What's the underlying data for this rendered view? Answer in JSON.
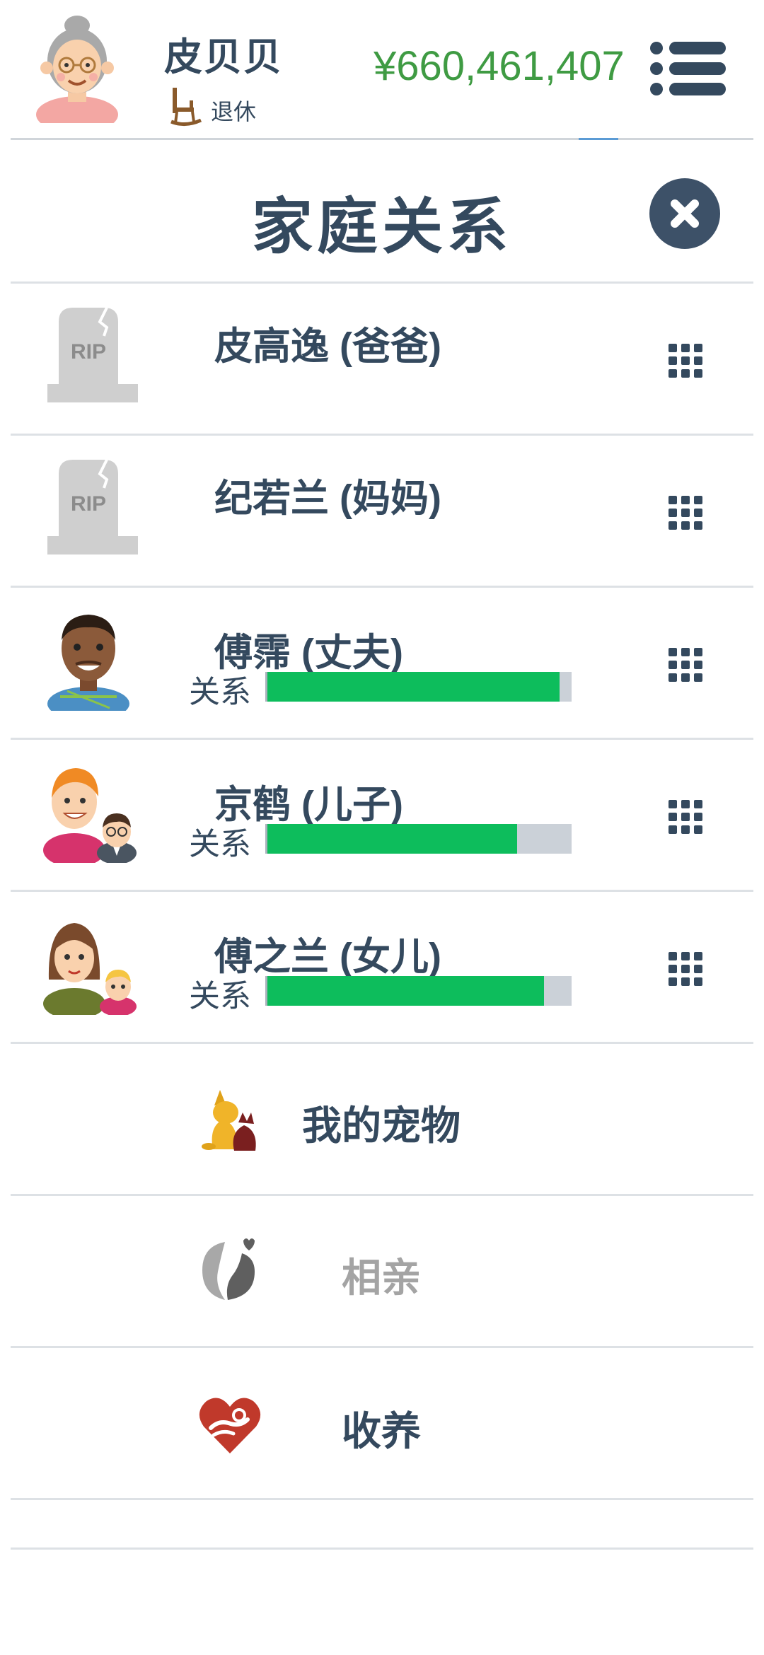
{
  "header": {
    "player_name": "皮贝贝",
    "status": "退休",
    "money": "¥660,461,407"
  },
  "modal": {
    "title": "家庭关系"
  },
  "relatives": [
    {
      "name": "皮高逸 (爸爸)",
      "deceased": true,
      "avatar": "rip-tombstone-icon"
    },
    {
      "name": "纪若兰 (妈妈)",
      "deceased": true,
      "avatar": "rip-tombstone-icon"
    },
    {
      "name": "傅霈 (丈夫)",
      "deceased": false,
      "relationship_label": "关系",
      "relationship": 0.96,
      "avatar": "husband-avatar"
    },
    {
      "name": "京鹤 (儿子)",
      "deceased": false,
      "relationship_label": "关系",
      "relationship": 0.82,
      "avatar": "son-avatar"
    },
    {
      "name": "傅之兰 (女儿)",
      "deceased": false,
      "relationship_label": "关系",
      "relationship": 0.91,
      "avatar": "daughter-avatar"
    }
  ],
  "actions": [
    {
      "label": "我的宠物",
      "icon": "pet-icon",
      "enabled": true
    },
    {
      "label": "相亲",
      "icon": "dating-icon",
      "enabled": false
    },
    {
      "label": "收养",
      "icon": "adoption-heart-icon",
      "enabled": true
    }
  ],
  "colors": {
    "text": "#34495e",
    "money": "#3f9b43",
    "relationship_fill": "#0dbd5c",
    "relationship_track": "#cbd1d8",
    "close_button": "#3d5168",
    "disabled_text": "#a4a4a4"
  }
}
